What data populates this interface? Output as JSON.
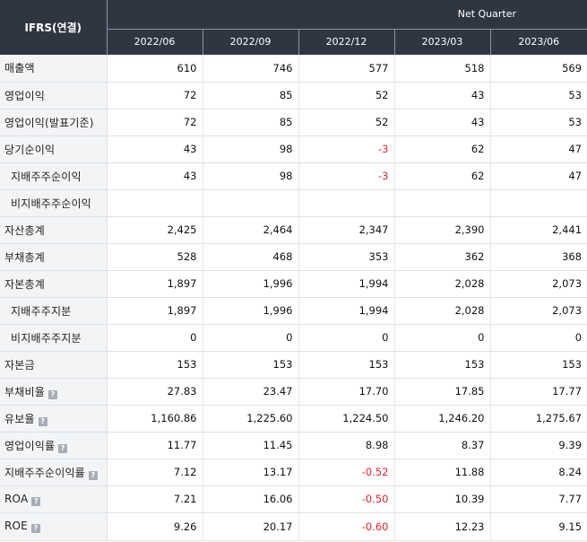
{
  "header": {
    "title": "IFRS(연결)",
    "group_label": "Net Quarter",
    "periods": [
      "2022/06",
      "2022/09",
      "2022/12",
      "2023/03",
      "2023/06"
    ]
  },
  "help_icon_glyph": "?",
  "rows": [
    {
      "label": "매출액",
      "values": [
        "610",
        "746",
        "577",
        "518",
        "569"
      ]
    },
    {
      "label": "영업이익",
      "values": [
        "72",
        "85",
        "52",
        "43",
        "53"
      ]
    },
    {
      "label": "영업이익(발표기준)",
      "values": [
        "72",
        "85",
        "52",
        "43",
        "53"
      ]
    },
    {
      "label": "당기순이익",
      "values": [
        "43",
        "98",
        "-3",
        "62",
        "47"
      ]
    },
    {
      "label": "지배주주순이익",
      "values": [
        "43",
        "98",
        "-3",
        "62",
        "47"
      ]
    },
    {
      "label": "비지배주주순이익",
      "values": [
        "",
        "",
        "",
        "",
        ""
      ]
    },
    {
      "label": "자산총계",
      "values": [
        "2,425",
        "2,464",
        "2,347",
        "2,390",
        "2,441"
      ]
    },
    {
      "label": "부채총계",
      "values": [
        "528",
        "468",
        "353",
        "362",
        "368"
      ]
    },
    {
      "label": "자본총계",
      "values": [
        "1,897",
        "1,996",
        "1,994",
        "2,028",
        "2,073"
      ]
    },
    {
      "label": "지배주주지분",
      "values": [
        "1,897",
        "1,996",
        "1,994",
        "2,028",
        "2,073"
      ]
    },
    {
      "label": "비지배주주지분",
      "values": [
        "0",
        "0",
        "0",
        "0",
        "0"
      ]
    },
    {
      "label": "자본금",
      "values": [
        "153",
        "153",
        "153",
        "153",
        "153"
      ]
    },
    {
      "label": "부채비율",
      "values": [
        "27.83",
        "23.47",
        "17.70",
        "17.85",
        "17.77"
      ]
    },
    {
      "label": "유보율",
      "values": [
        "1,160.86",
        "1,225.60",
        "1,224.50",
        "1,246.20",
        "1,275.67"
      ]
    },
    {
      "label": "영업이익률",
      "values": [
        "11.77",
        "11.45",
        "8.98",
        "8.37",
        "9.39"
      ]
    },
    {
      "label": "지배주주순이익률",
      "values": [
        "7.12",
        "13.17",
        "-0.52",
        "11.88",
        "8.24"
      ]
    },
    {
      "label": "ROA",
      "values": [
        "7.21",
        "16.06",
        "-0.50",
        "10.39",
        "7.77"
      ]
    },
    {
      "label": "ROE",
      "values": [
        "9.26",
        "20.17",
        "-0.60",
        "12.23",
        "9.15"
      ]
    }
  ],
  "colors": {
    "header_bg": "#2f3642",
    "label_bg": "#f3f4f6",
    "negative": "#e3212e",
    "help_icon_bg": "#a7adb6"
  }
}
